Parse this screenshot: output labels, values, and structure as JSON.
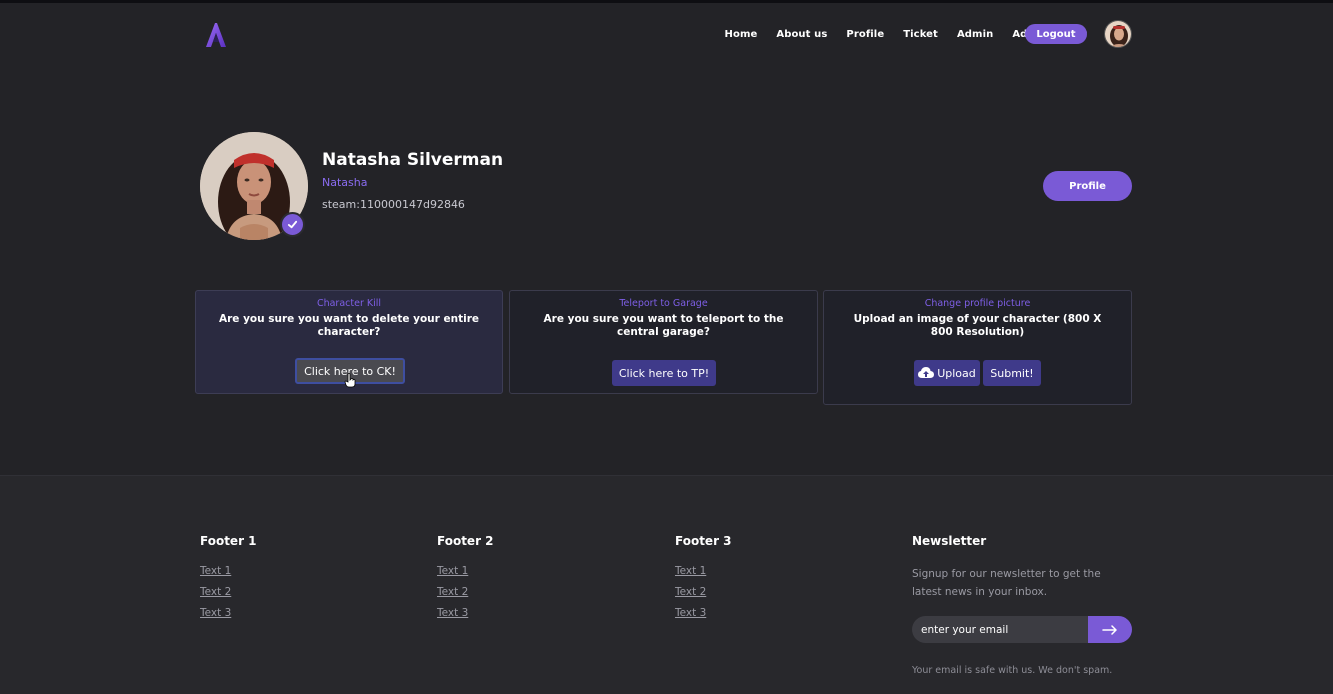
{
  "nav": {
    "items": [
      "Home",
      "About us",
      "Profile",
      "Ticket",
      "Admin",
      "Admin Ticket"
    ],
    "logout_label": "Logout"
  },
  "profile": {
    "name": "Natasha Silverman",
    "nickname": "Natasha",
    "steam_id": "steam:110000147d92846",
    "button_label": "Profile"
  },
  "cards": [
    {
      "label": "Character Kill",
      "text": "Are you sure you want to delete your entire character?",
      "button": "Click here to CK!"
    },
    {
      "label": "Teleport to Garage",
      "text": "Are you sure you want to teleport to the central garage?",
      "button": "Click here to TP!"
    },
    {
      "label": "Change profile picture",
      "text": "Upload an image of your character (800 X 800 Resolution)",
      "upload_button": "Upload",
      "submit_button": "Submit!"
    }
  ],
  "footer": {
    "columns": [
      {
        "title": "Footer 1",
        "items": [
          "Text 1",
          "Text 2",
          "Text 3"
        ]
      },
      {
        "title": "Footer 2",
        "items": [
          "Text 1",
          "Text 2",
          "Text 3"
        ]
      },
      {
        "title": "Footer 3",
        "items": [
          "Text 1",
          "Text 2",
          "Text 3"
        ]
      }
    ],
    "newsletter": {
      "title": "Newsletter",
      "text": "Signup for our newsletter to get the latest news in your inbox.",
      "placeholder": "enter your email",
      "note": "Your email is safe with us. We don't spam."
    }
  },
  "colors": {
    "accent": "#7a5ad6",
    "background": "#232327",
    "footer_background": "#28282c",
    "card_button": "#3f3a8a"
  },
  "icons": [
    "logo-icon",
    "verified-check-icon",
    "cloud-upload-icon",
    "arrow-right-icon",
    "hand-cursor-icon"
  ]
}
